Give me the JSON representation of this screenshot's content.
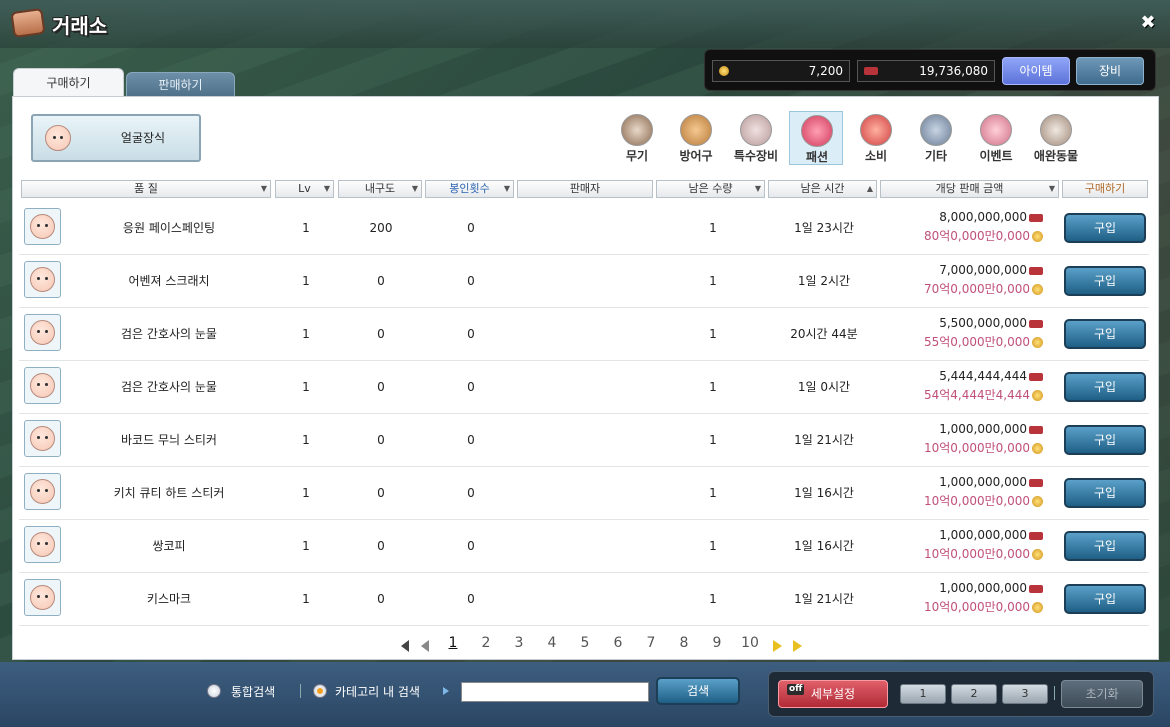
{
  "window": {
    "title": "거래소",
    "close_label": "✖"
  },
  "currency": {
    "meso": "7,200",
    "cash": "19,736,080",
    "cash_tag": "캐시"
  },
  "toggles": {
    "item": "아이템",
    "equip": "장비"
  },
  "tabs": {
    "buy": "구매하기",
    "sell": "판매하기"
  },
  "current_category": {
    "label": "얼굴장식"
  },
  "categories": [
    {
      "label": "무기"
    },
    {
      "label": "방어구"
    },
    {
      "label": "특수장비"
    },
    {
      "label": "패션"
    },
    {
      "label": "소비"
    },
    {
      "label": "기타"
    },
    {
      "label": "이벤트"
    },
    {
      "label": "애완동물"
    }
  ],
  "columns": {
    "quality": "품 질",
    "lv": "Lv",
    "durability": "내구도",
    "seal": "봉인횟수",
    "seller": "판매자",
    "qty": "남은 수량",
    "time": "남은 시간",
    "price": "개당 판매 금액",
    "buy": "구매하기"
  },
  "buy_label": "구입",
  "rows": [
    {
      "name": "응원 페이스페인팅",
      "lv": "1",
      "durability": "200",
      "seal": "0",
      "qty": "1",
      "time": "1일 23시간",
      "price": "8,000,000,000",
      "price_kr": "80억0,000만0,000"
    },
    {
      "name": "어벤져 스크래치",
      "lv": "1",
      "durability": "0",
      "seal": "0",
      "qty": "1",
      "time": "1일 2시간",
      "price": "7,000,000,000",
      "price_kr": "70억0,000만0,000"
    },
    {
      "name": "검은 간호사의 눈물",
      "lv": "1",
      "durability": "0",
      "seal": "0",
      "qty": "1",
      "time": "20시간 44분",
      "price": "5,500,000,000",
      "price_kr": "55억0,000만0,000"
    },
    {
      "name": "검은 간호사의 눈물",
      "lv": "1",
      "durability": "0",
      "seal": "0",
      "qty": "1",
      "time": "1일 0시간",
      "price": "5,444,444,444",
      "price_kr": "54억4,444만4,444"
    },
    {
      "name": "바코드 무늬 스티커",
      "lv": "1",
      "durability": "0",
      "seal": "0",
      "qty": "1",
      "time": "1일 21시간",
      "price": "1,000,000,000",
      "price_kr": "10억0,000만0,000"
    },
    {
      "name": "키치 큐티 하트 스티커",
      "lv": "1",
      "durability": "0",
      "seal": "0",
      "qty": "1",
      "time": "1일 16시간",
      "price": "1,000,000,000",
      "price_kr": "10억0,000만0,000"
    },
    {
      "name": "쌍코피",
      "lv": "1",
      "durability": "0",
      "seal": "0",
      "qty": "1",
      "time": "1일 16시간",
      "price": "1,000,000,000",
      "price_kr": "10억0,000만0,000"
    },
    {
      "name": "키스마크",
      "lv": "1",
      "durability": "0",
      "seal": "0",
      "qty": "1",
      "time": "1일 21시간",
      "price": "1,000,000,000",
      "price_kr": "10억0,000만0,000"
    }
  ],
  "pagination": {
    "pages": [
      "1",
      "2",
      "3",
      "4",
      "5",
      "6",
      "7",
      "8",
      "9",
      "10"
    ],
    "current": "1"
  },
  "bottom": {
    "radio_all": "통합검색",
    "radio_category": "카테고리 내 검색",
    "search_value": "",
    "search_label": "검색",
    "adv_label": "세부설정",
    "adv_badge": "off",
    "slots": [
      "1",
      "2",
      "3"
    ],
    "reset_label": "초기화"
  },
  "colors": {
    "accent": "#1f5f86",
    "price_kr": "#c0507a",
    "adv": "#b12a36"
  }
}
